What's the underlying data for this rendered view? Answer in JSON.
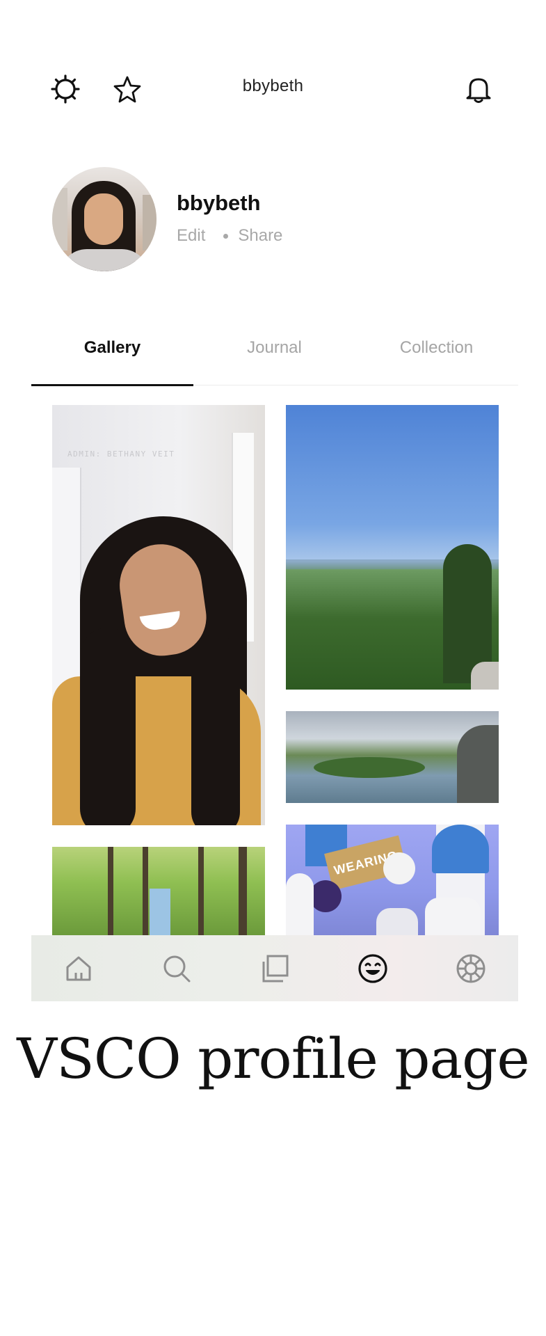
{
  "header": {
    "title": "bbybeth",
    "left_icons": [
      "settings-icon",
      "star-icon"
    ],
    "right_icons": [
      "bell-icon"
    ]
  },
  "profile": {
    "username": "bbybeth",
    "edit_label": "Edit",
    "share_label": "Share"
  },
  "tabs": [
    {
      "label": "Gallery",
      "active": true
    },
    {
      "label": "Journal",
      "active": false
    },
    {
      "label": "Collection",
      "active": false
    }
  ],
  "gallery": {
    "photo_caption": "ADMIN: BETHANY VEIT",
    "sign_text": "WEARING"
  },
  "bottom_nav": [
    "home-icon",
    "search-icon",
    "studio-icon",
    "profile-icon",
    "camera-icon"
  ],
  "caption": "VSCO profile page",
  "colors": {
    "accent": "#111111",
    "muted": "#a5a5a5"
  }
}
